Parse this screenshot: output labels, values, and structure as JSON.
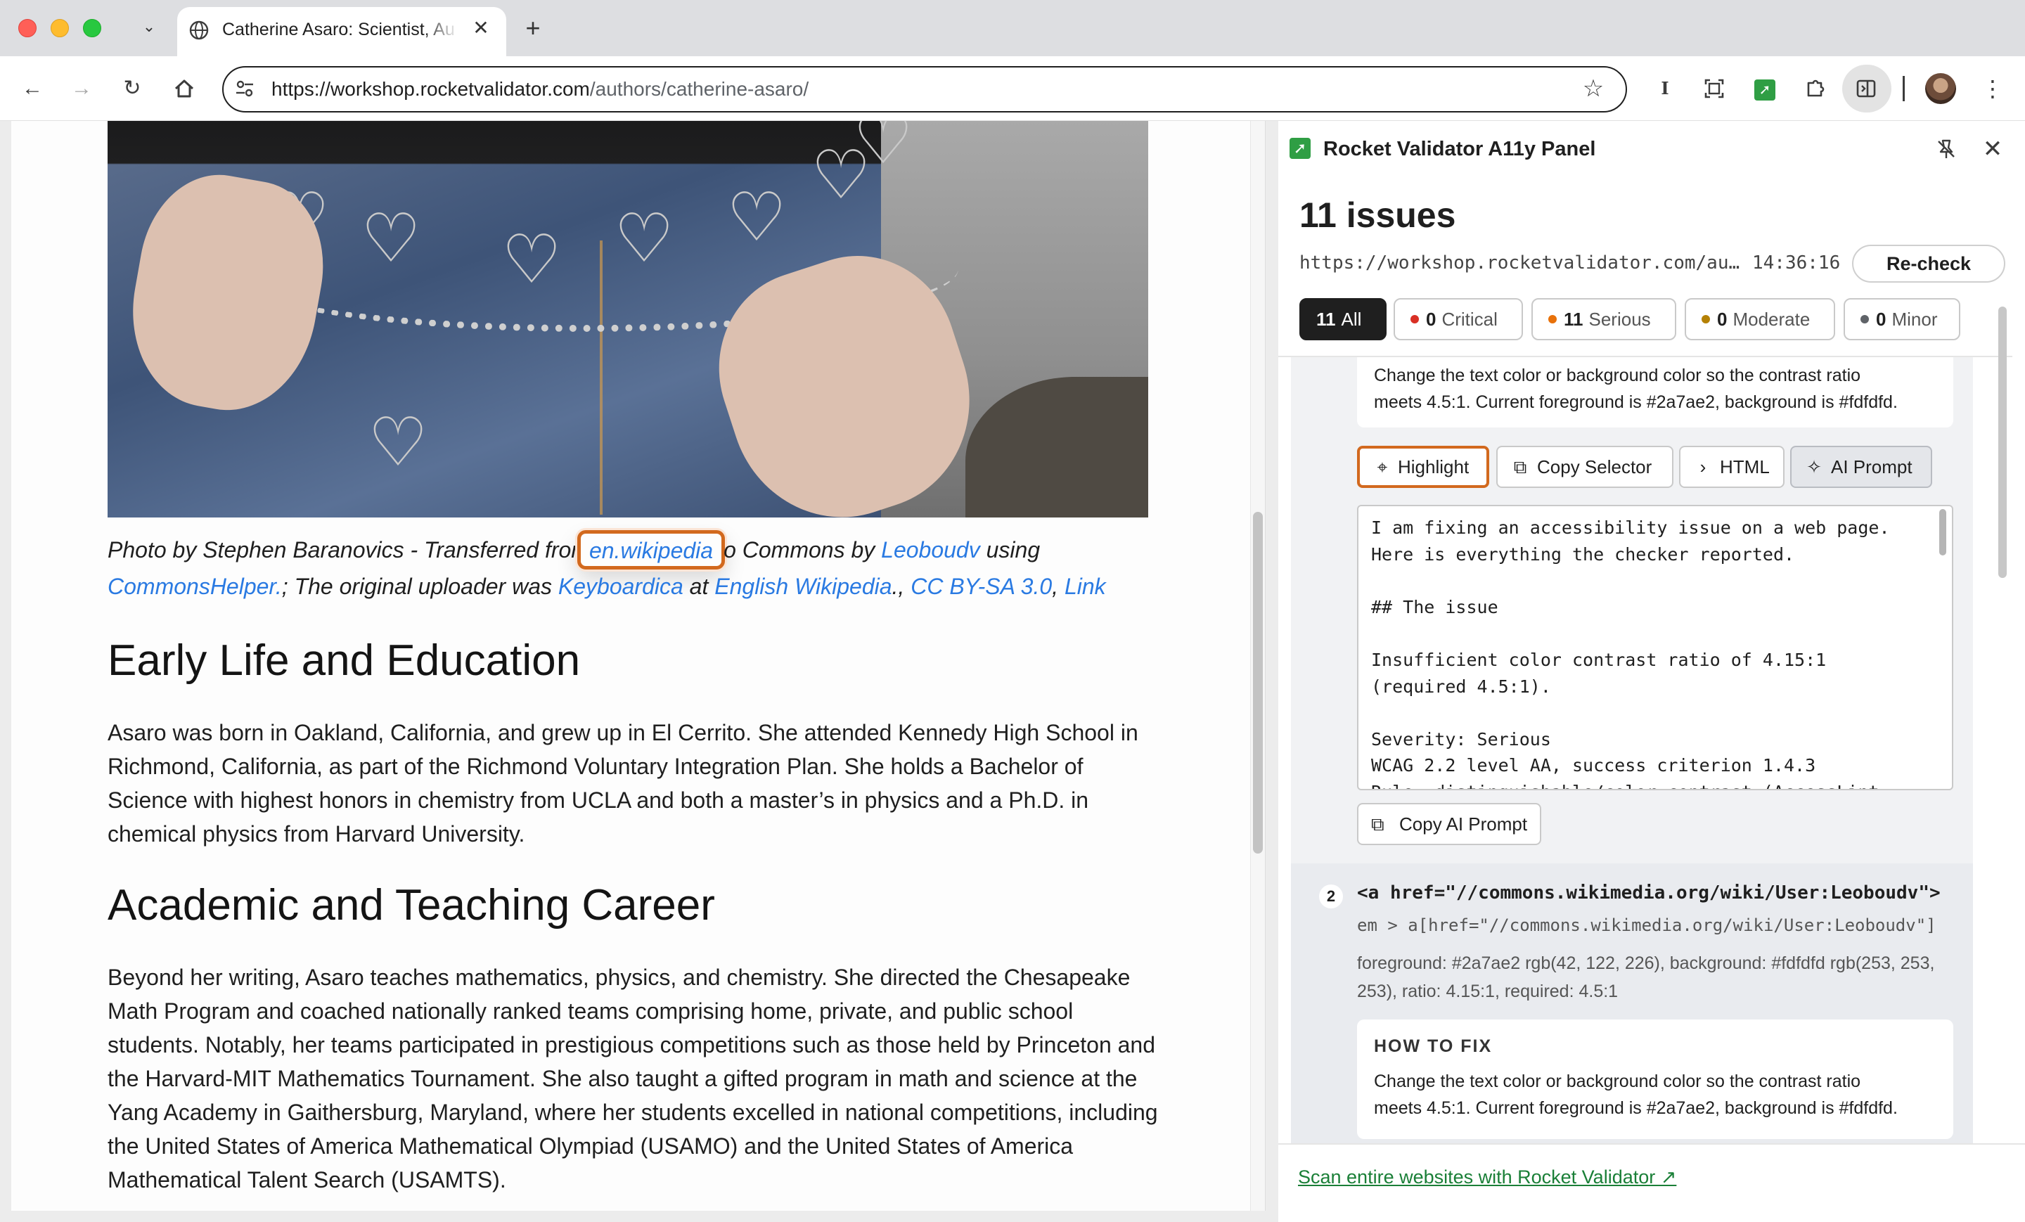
{
  "browser": {
    "tab_title": "Catherine Asaro: Scientist, Au",
    "url_host": "https://workshop.rocketvalidator.com",
    "url_path": "/authors/catherine-asaro/"
  },
  "page": {
    "caption": {
      "part1": "Photo by Stephen Baranovics - Transferred fror",
      "link_wiki": "en.wikipedia",
      "part2": "o Commons by",
      "link_leoboudv": "Leoboudv",
      "part3": "using",
      "link_commonshelper": "CommonsHelper.",
      "part4": "; The original uploader was",
      "link_keyboardica": "Keyboardica",
      "part5": "at",
      "link_english_wiki": "English Wikipedia",
      "part6": "., ",
      "link_license": "CC BY-SA 3.0",
      "part7": ", ",
      "link_link": "Link"
    },
    "heading_early": "Early Life and Education",
    "para_early": "Asaro was born in Oakland, California, and grew up in El Cerrito. She attended Kennedy High School in Richmond, California, as part of the Richmond Voluntary Integration Plan. She holds a Bachelor of Science with highest honors in chemistry from UCLA and both a master’s in physics and a Ph.D. in chemical physics from Harvard University.",
    "heading_academic": "Academic and Teaching Career",
    "para_academic": "Beyond her writing, Asaro teaches mathematics, physics, and chemistry. She directed the Chesapeake Math Program and coached nationally ranked teams comprising home, private, and public school students. Notably, her teams participated in prestigious competitions such as those held by Princeton and the Harvard-MIT Mathematics Tournament. She also taught a gifted program in math and science at the Yang Academy in Gaithersburg, Maryland, where her students excelled in national competitions, including the United States of America Mathematical Olympiad (USAMO) and the United States of America Mathematical Talent Search (USAMTS)."
  },
  "panel": {
    "title": "Rocket Validator A11y Panel",
    "issues_count": "11 issues",
    "checked_url": "https://workshop.rocketvalidator.com/au…",
    "checked_time": "14:36:16",
    "recheck_label": "Re-check",
    "filters": [
      {
        "count": "11",
        "label": "All",
        "color": ""
      },
      {
        "count": "0",
        "label": "Critical",
        "color": "#d93025"
      },
      {
        "count": "11",
        "label": "Serious",
        "color": "#e8710a"
      },
      {
        "count": "0",
        "label": "Moderate",
        "color": "#b58105"
      },
      {
        "count": "0",
        "label": "Minor",
        "color": "#5f6368"
      }
    ],
    "issue1": {
      "fix_text_line1": "Change the text color or background color so the contrast ratio",
      "fix_text_line2": "meets 4.5:1. Current foreground is #2a7ae2, background is #fdfdfd.",
      "actions": {
        "highlight": "Highlight",
        "copy_selector": "Copy Selector",
        "html": "HTML",
        "ai_prompt": "AI Prompt"
      },
      "prompt": "I am fixing an accessibility issue on a web page.\nHere is everything the checker reported.\n\n## The issue\n\nInsufficient color contrast ratio of 4.15:1\n(required 4.5:1).\n\nSeverity: Serious\nWCAG 2.2 level AA, success criterion 1.4.3\nRule: distinguishable/color-contrast (AccessLint",
      "copy_prompt_label": "Copy AI Prompt"
    },
    "issue2": {
      "number": "2",
      "html": "<a href=\"//commons.wikimedia.org/wiki/User:Leoboudv\">",
      "selector": "em > a[href=\"//commons.wikimedia.org/wiki/User:Leoboudv\"]",
      "detail": "foreground: #2a7ae2 rgb(42, 122, 226), background: #fdfdfd rgb(253, 253, 253), ratio: 4.15:1, required: 4.5:1",
      "fix_heading": "HOW TO FIX",
      "fix_text_line1": "Change the text color or background color so the contrast ratio",
      "fix_text_line2": "meets 4.5:1. Current foreground is #2a7ae2, background is #fdfdfd."
    },
    "footer_link": "Scan entire websites with Rocket Validator ↗"
  },
  "icons": {
    "back": "arrow-left-icon",
    "forward": "arrow-right-icon",
    "reload": "reload-icon",
    "home": "home-icon",
    "star": "star-icon",
    "extensions": "puzzle-icon",
    "side_panel": "side-panel-icon"
  },
  "colors": {
    "link": "#2a7ae2",
    "highlight_outline": "#d2691e",
    "brand_green": "#2f9e44"
  }
}
